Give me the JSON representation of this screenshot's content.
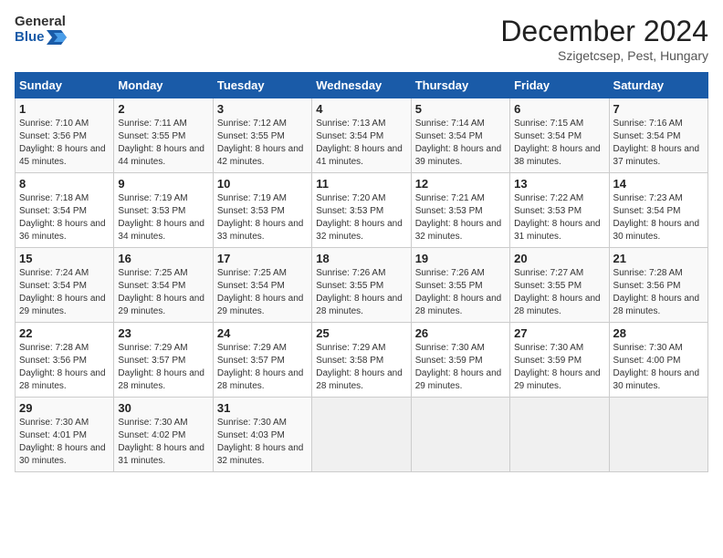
{
  "logo": {
    "text_general": "General",
    "text_blue": "Blue"
  },
  "title": "December 2024",
  "location": "Szigetcsep, Pest, Hungary",
  "days_of_week": [
    "Sunday",
    "Monday",
    "Tuesday",
    "Wednesday",
    "Thursday",
    "Friday",
    "Saturday"
  ],
  "weeks": [
    [
      {
        "day": "1",
        "sunrise": "7:10 AM",
        "sunset": "3:56 PM",
        "daylight": "8 hours and 45 minutes."
      },
      {
        "day": "2",
        "sunrise": "7:11 AM",
        "sunset": "3:55 PM",
        "daylight": "8 hours and 44 minutes."
      },
      {
        "day": "3",
        "sunrise": "7:12 AM",
        "sunset": "3:55 PM",
        "daylight": "8 hours and 42 minutes."
      },
      {
        "day": "4",
        "sunrise": "7:13 AM",
        "sunset": "3:54 PM",
        "daylight": "8 hours and 41 minutes."
      },
      {
        "day": "5",
        "sunrise": "7:14 AM",
        "sunset": "3:54 PM",
        "daylight": "8 hours and 39 minutes."
      },
      {
        "day": "6",
        "sunrise": "7:15 AM",
        "sunset": "3:54 PM",
        "daylight": "8 hours and 38 minutes."
      },
      {
        "day": "7",
        "sunrise": "7:16 AM",
        "sunset": "3:54 PM",
        "daylight": "8 hours and 37 minutes."
      }
    ],
    [
      {
        "day": "8",
        "sunrise": "7:18 AM",
        "sunset": "3:54 PM",
        "daylight": "8 hours and 36 minutes."
      },
      {
        "day": "9",
        "sunrise": "7:19 AM",
        "sunset": "3:53 PM",
        "daylight": "8 hours and 34 minutes."
      },
      {
        "day": "10",
        "sunrise": "7:19 AM",
        "sunset": "3:53 PM",
        "daylight": "8 hours and 33 minutes."
      },
      {
        "day": "11",
        "sunrise": "7:20 AM",
        "sunset": "3:53 PM",
        "daylight": "8 hours and 32 minutes."
      },
      {
        "day": "12",
        "sunrise": "7:21 AM",
        "sunset": "3:53 PM",
        "daylight": "8 hours and 32 minutes."
      },
      {
        "day": "13",
        "sunrise": "7:22 AM",
        "sunset": "3:53 PM",
        "daylight": "8 hours and 31 minutes."
      },
      {
        "day": "14",
        "sunrise": "7:23 AM",
        "sunset": "3:54 PM",
        "daylight": "8 hours and 30 minutes."
      }
    ],
    [
      {
        "day": "15",
        "sunrise": "7:24 AM",
        "sunset": "3:54 PM",
        "daylight": "8 hours and 29 minutes."
      },
      {
        "day": "16",
        "sunrise": "7:25 AM",
        "sunset": "3:54 PM",
        "daylight": "8 hours and 29 minutes."
      },
      {
        "day": "17",
        "sunrise": "7:25 AM",
        "sunset": "3:54 PM",
        "daylight": "8 hours and 29 minutes."
      },
      {
        "day": "18",
        "sunrise": "7:26 AM",
        "sunset": "3:55 PM",
        "daylight": "8 hours and 28 minutes."
      },
      {
        "day": "19",
        "sunrise": "7:26 AM",
        "sunset": "3:55 PM",
        "daylight": "8 hours and 28 minutes."
      },
      {
        "day": "20",
        "sunrise": "7:27 AM",
        "sunset": "3:55 PM",
        "daylight": "8 hours and 28 minutes."
      },
      {
        "day": "21",
        "sunrise": "7:28 AM",
        "sunset": "3:56 PM",
        "daylight": "8 hours and 28 minutes."
      }
    ],
    [
      {
        "day": "22",
        "sunrise": "7:28 AM",
        "sunset": "3:56 PM",
        "daylight": "8 hours and 28 minutes."
      },
      {
        "day": "23",
        "sunrise": "7:29 AM",
        "sunset": "3:57 PM",
        "daylight": "8 hours and 28 minutes."
      },
      {
        "day": "24",
        "sunrise": "7:29 AM",
        "sunset": "3:57 PM",
        "daylight": "8 hours and 28 minutes."
      },
      {
        "day": "25",
        "sunrise": "7:29 AM",
        "sunset": "3:58 PM",
        "daylight": "8 hours and 28 minutes."
      },
      {
        "day": "26",
        "sunrise": "7:30 AM",
        "sunset": "3:59 PM",
        "daylight": "8 hours and 29 minutes."
      },
      {
        "day": "27",
        "sunrise": "7:30 AM",
        "sunset": "3:59 PM",
        "daylight": "8 hours and 29 minutes."
      },
      {
        "day": "28",
        "sunrise": "7:30 AM",
        "sunset": "4:00 PM",
        "daylight": "8 hours and 30 minutes."
      }
    ],
    [
      {
        "day": "29",
        "sunrise": "7:30 AM",
        "sunset": "4:01 PM",
        "daylight": "8 hours and 30 minutes."
      },
      {
        "day": "30",
        "sunrise": "7:30 AM",
        "sunset": "4:02 PM",
        "daylight": "8 hours and 31 minutes."
      },
      {
        "day": "31",
        "sunrise": "7:30 AM",
        "sunset": "4:03 PM",
        "daylight": "8 hours and 32 minutes."
      },
      null,
      null,
      null,
      null
    ]
  ]
}
